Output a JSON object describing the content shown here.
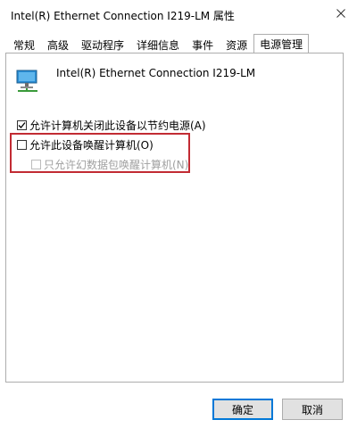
{
  "window": {
    "title": "Intel(R) Ethernet Connection I219-LM 属性"
  },
  "tabs": [
    {
      "label": "常规"
    },
    {
      "label": "高级"
    },
    {
      "label": "驱动程序"
    },
    {
      "label": "详细信息"
    },
    {
      "label": "事件"
    },
    {
      "label": "资源"
    },
    {
      "label": "电源管理"
    }
  ],
  "active_tab": "电源管理",
  "device": {
    "name": "Intel(R) Ethernet Connection I219-LM",
    "icon": "network-adapter-icon"
  },
  "options": {
    "allow_turn_off": {
      "label": "允许计算机关闭此设备以节约电源(A)",
      "checked": true,
      "enabled": true
    },
    "allow_wake": {
      "label": "允许此设备唤醒计算机(O)",
      "checked": false,
      "enabled": true
    },
    "magic_packet_only": {
      "label": "只允许幻数据包唤醒计算机(N)",
      "checked": false,
      "enabled": false
    }
  },
  "buttons": {
    "ok": "确定",
    "cancel": "取消"
  },
  "colors": {
    "highlight": "#c22b33",
    "default_button_border": "#0078d7"
  }
}
